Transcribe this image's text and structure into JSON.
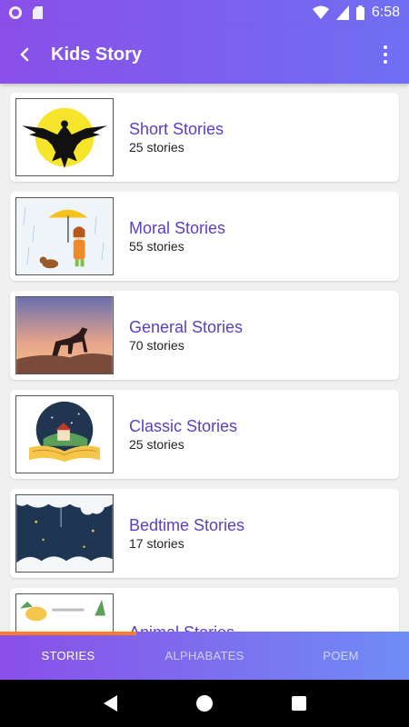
{
  "status_bar": {
    "time": "6:58"
  },
  "app_bar": {
    "title": "Kids Story",
    "back_icon": "arrow-back-icon",
    "menu_icon": "more-vert-icon"
  },
  "stories": [
    {
      "title": "Short Stories",
      "count": "25 stories"
    },
    {
      "title": "Moral Stories",
      "count": "55 stories"
    },
    {
      "title": "General Stories",
      "count": "70 stories"
    },
    {
      "title": "Classic Stories",
      "count": "25 stories"
    },
    {
      "title": "Bedtime Stories",
      "count": "17 stories"
    },
    {
      "title": "Animal Stories",
      "count": ""
    }
  ],
  "tabs": [
    {
      "label": "STORIES",
      "active": true
    },
    {
      "label": "ALPHABATES",
      "active": false
    },
    {
      "label": "POEM",
      "active": false
    }
  ],
  "colors": {
    "accent": "#8a4fe8",
    "title_text": "#5b3fc2",
    "tab_indicator": "#ff7a29"
  }
}
